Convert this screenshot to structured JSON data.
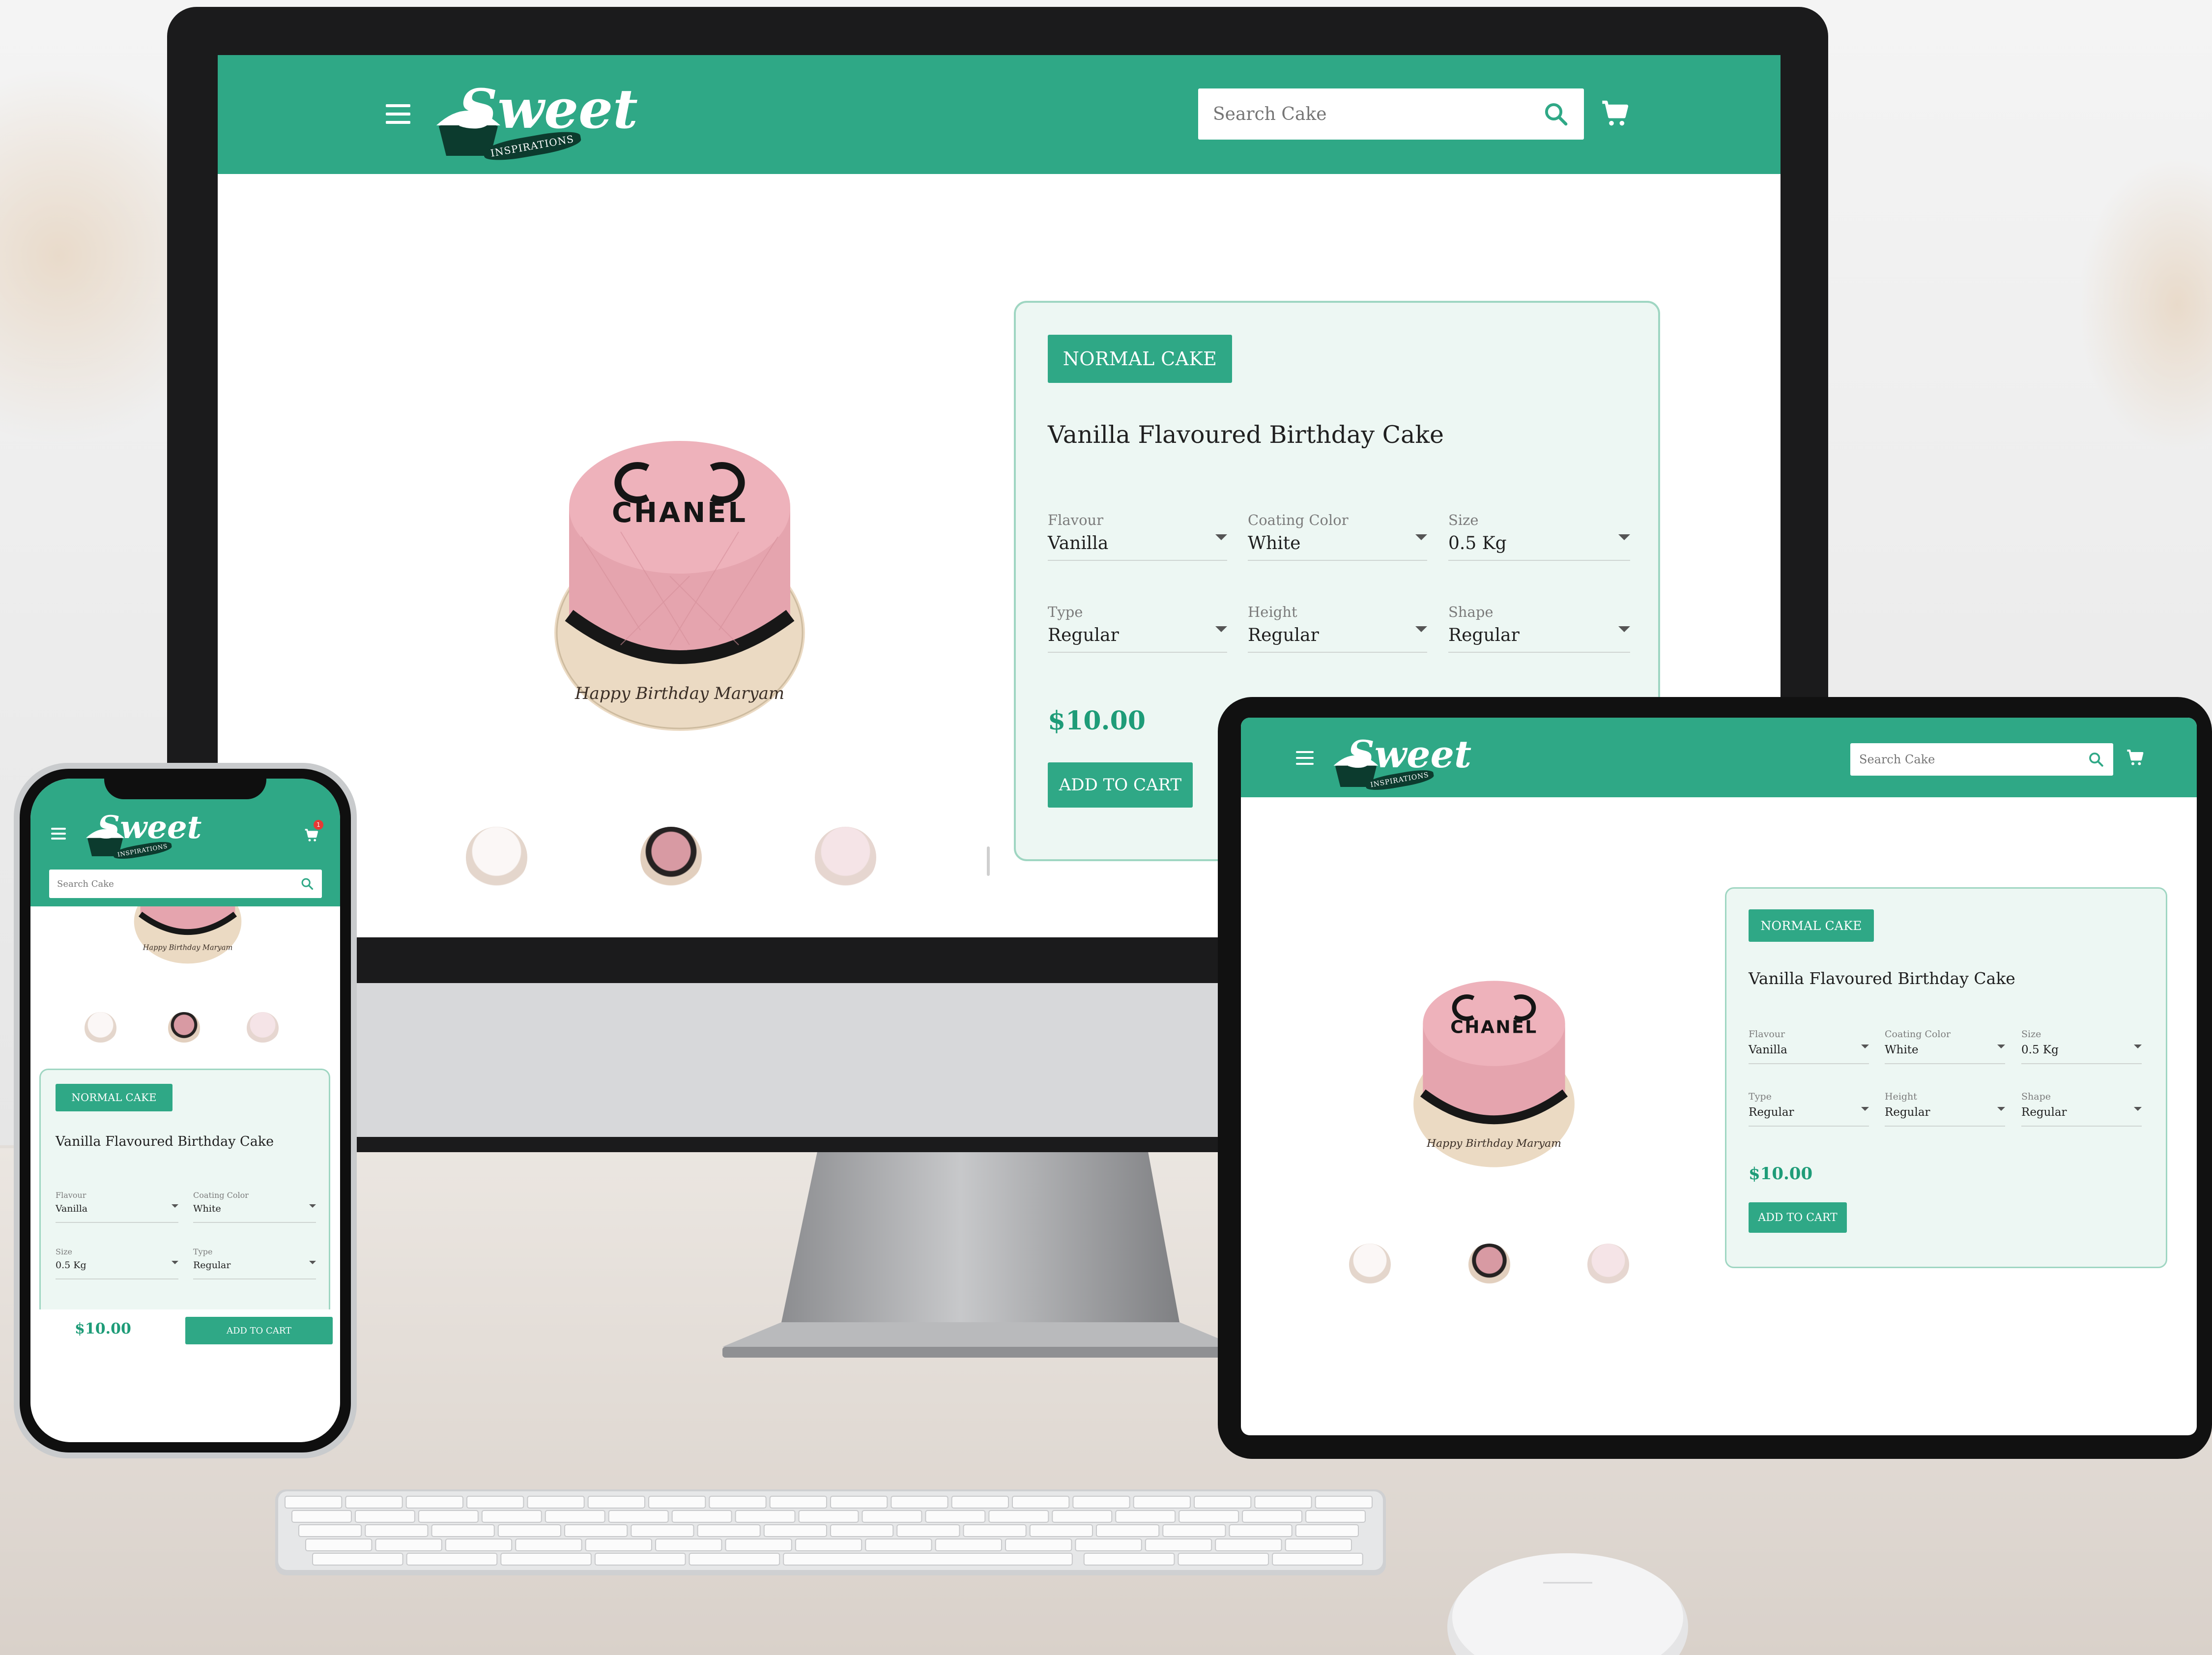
{
  "brand": {
    "logo_text": "Sweet",
    "logo_subtext": "INSPIRATIONS",
    "header_color": "#2fa886",
    "accent_color": "#2fa886",
    "price_color": "#1e9c78",
    "card_background": "#edf7f3"
  },
  "header": {
    "menu_icon": "hamburger-menu-icon",
    "search_placeholder": "Search Cake",
    "search_icon": "search-icon",
    "cart_icon": "shopping-cart-icon",
    "cart_badge_count": "1"
  },
  "product": {
    "category_badge": "NORMAL CAKE",
    "title": "Vanilla Flavoured Birthday Cake",
    "cake_topper_text": "CHANEL",
    "cake_writing": "Happy Birthday Maryam",
    "options": [
      {
        "label": "Flavour",
        "value": "Vanilla"
      },
      {
        "label": "Coating Color",
        "value": "White"
      },
      {
        "label": "Size",
        "value": "0.5 Kg"
      },
      {
        "label": "Type",
        "value": "Regular"
      },
      {
        "label": "Height",
        "value": "Regular"
      },
      {
        "label": "Shape",
        "value": "Regular"
      }
    ],
    "price": "$10.00",
    "add_to_cart_label": "ADD TO CART",
    "dropdown_icon": "caret-down-icon"
  },
  "thumbnails": [
    "white-cake-thumbnail",
    "chanel-cake-thumbnail",
    "pink-cake-thumbnail"
  ]
}
